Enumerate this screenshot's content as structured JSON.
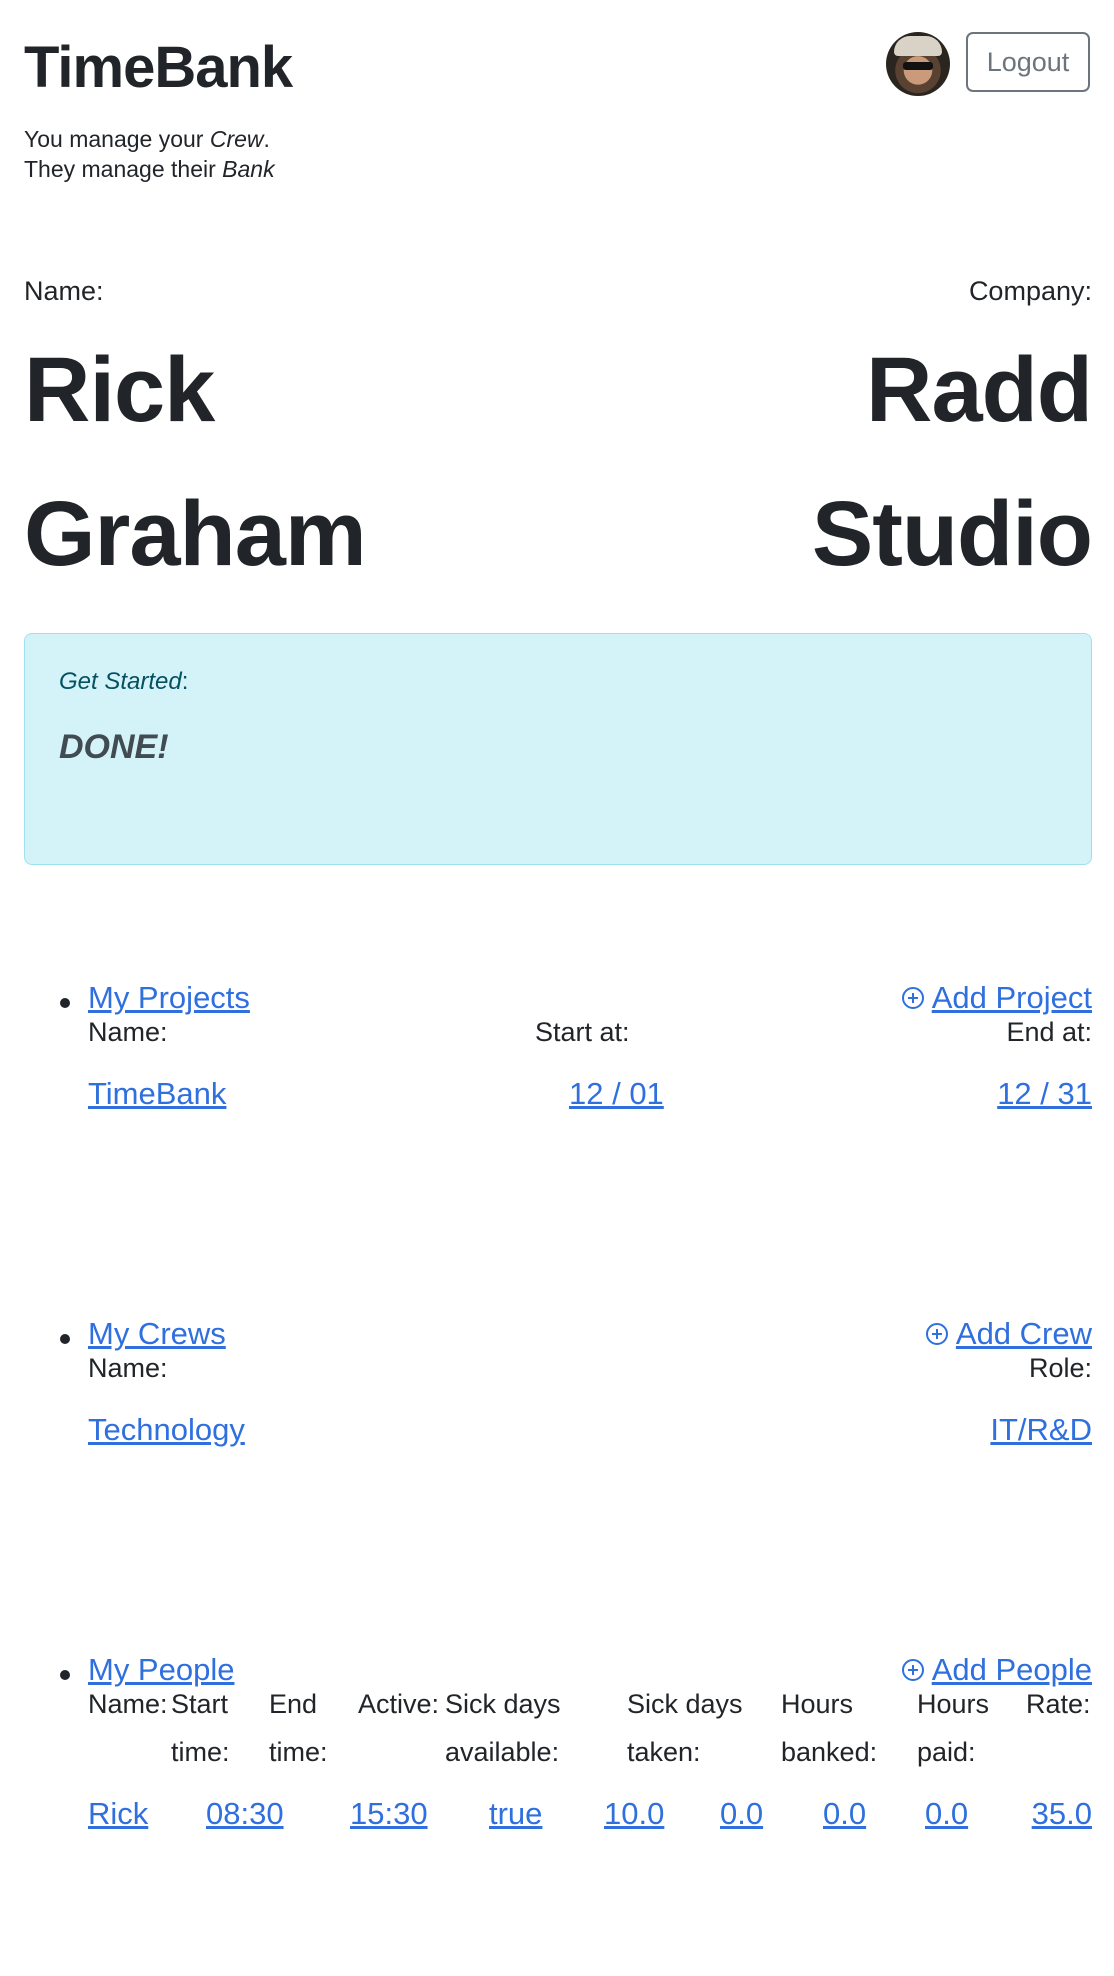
{
  "header": {
    "brand": "TimeBank",
    "tagline_line1_pre": "You manage your ",
    "tagline_line1_em": "Crew",
    "tagline_line1_post": ".",
    "tagline_line2_pre": "They manage their ",
    "tagline_line2_em": "Bank",
    "logout_label": "Logout"
  },
  "profile": {
    "name_label": "Name:",
    "company_label": "Company:",
    "first_name": "Rick",
    "last_name": "Graham",
    "company_line1": "Radd",
    "company_line2": "Studio"
  },
  "get_started": {
    "heading": "Get Started",
    "heading_suffix": ":",
    "status": "DONE!"
  },
  "projects": {
    "title": "My Projects",
    "add_label": "Add Project",
    "columns": [
      "Name:",
      "Start at:",
      "End at:"
    ],
    "rows": [
      {
        "name": "TimeBank",
        "start": "12 / 01",
        "end": "12 / 31"
      }
    ]
  },
  "crews": {
    "title": "My Crews",
    "add_label": "Add Crew",
    "columns": [
      "Name:",
      "Role:"
    ],
    "rows": [
      {
        "name": "Technology",
        "role": "IT/R&D"
      }
    ]
  },
  "people": {
    "title": "My People",
    "add_label": "Add People",
    "columns": [
      "Name:",
      "Start time:",
      "End time:",
      "Active:",
      "Sick days available:",
      "Sick days taken:",
      "Hours banked:",
      "Hours paid:",
      "Rate:"
    ],
    "rows": [
      {
        "name": "Rick",
        "start": "08:30",
        "end": "15:30",
        "active": "true",
        "sick_available": "10.0",
        "sick_taken": "0.0",
        "hours_banked": "0.0",
        "hours_paid": "0.0",
        "rate": "35.0"
      }
    ]
  },
  "colors": {
    "link": "#2f6fde",
    "alert_bg": "#d4f3f9",
    "alert_border": "#9fe1ee",
    "text": "#212529"
  }
}
